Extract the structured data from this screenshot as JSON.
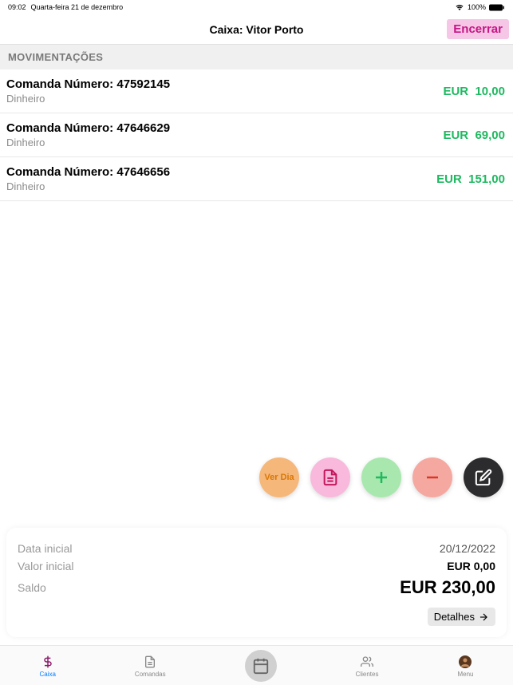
{
  "status_bar": {
    "time": "09:02",
    "date": "Quarta-feira 21 de dezembro",
    "battery": "100%"
  },
  "header": {
    "title": "Caixa: Vitor Porto",
    "close_label": "Encerrar"
  },
  "section_header": "MOVIMENTAÇÕES",
  "transactions": [
    {
      "title": "Comanda Número: 47592145",
      "subtitle": "Dinheiro",
      "amount": "EUR  10,00"
    },
    {
      "title": "Comanda Número: 47646629",
      "subtitle": "Dinheiro",
      "amount": "EUR  69,00"
    },
    {
      "title": "Comanda Número: 47646656",
      "subtitle": "Dinheiro",
      "amount": "EUR  151,00"
    }
  ],
  "actions": {
    "verdia_label": "Ver Dia"
  },
  "summary": {
    "start_date_label": "Data inicial",
    "start_date_value": "20/12/2022",
    "start_value_label": "Valor inicial",
    "start_value_value": "EUR 0,00",
    "balance_label": "Saldo",
    "balance_value": "EUR 230,00",
    "details_label": "Detalhes"
  },
  "tabs": {
    "caixa": "Caixa",
    "comandas": "Comandas",
    "clientes": "Clientes",
    "menu": "Menu"
  }
}
